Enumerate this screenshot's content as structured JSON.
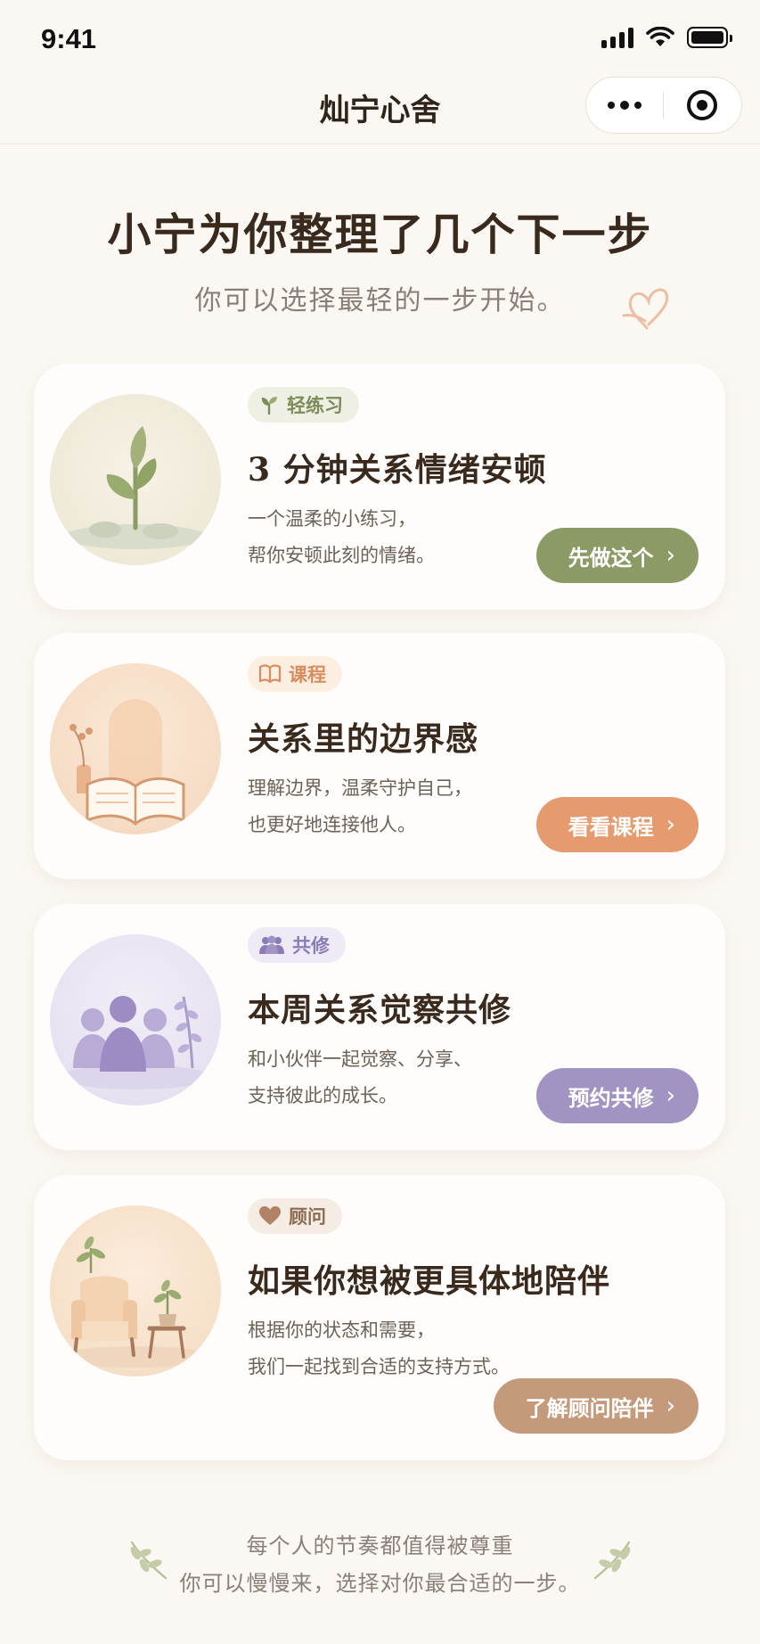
{
  "status_bar": {
    "time": "9:41"
  },
  "nav": {
    "title": "灿宁心舍"
  },
  "header": {
    "title": "小宁为你整理了几个下一步",
    "subtitle": "你可以选择最轻的一步开始。"
  },
  "cards": [
    {
      "badge": "轻练习",
      "title": "3 分钟关系情绪安顿",
      "desc": [
        "一个温柔的小练习，",
        "帮你安顿此刻的情绪。"
      ],
      "cta": "先做这个",
      "accent": "#8c9b66"
    },
    {
      "badge": "课程",
      "title": "关系里的边界感",
      "desc": [
        "理解边界，温柔守护自己，",
        "也更好地连接他人。"
      ],
      "cta": "看看课程",
      "accent": "#e59b6e"
    },
    {
      "badge": "共修",
      "title": "本周关系觉察共修",
      "desc": [
        "和小伙伴一起觉察、分享、",
        "支持彼此的成长。"
      ],
      "cta": "预约共修",
      "accent": "#a294c2"
    },
    {
      "badge": "顾问",
      "title": "如果你想被更具体地陪伴",
      "desc": [
        "根据你的状态和需要，",
        "我们一起找到合适的支持方式。"
      ],
      "cta": "了解顾问陪伴",
      "accent": "#c49a7a"
    }
  ],
  "footer": {
    "line1": "每个人的节奏都值得被尊重",
    "line2": "你可以慢慢来，选择对你最合适的一步。"
  },
  "icons": [
    "signal-icon",
    "wifi-icon",
    "battery-icon",
    "more-icon",
    "close-target-icon",
    "heart-doodle-icon",
    "sprout-icon",
    "book-icon",
    "people-icon",
    "heart-icon",
    "chevron-right-icon",
    "leaf-icon"
  ]
}
